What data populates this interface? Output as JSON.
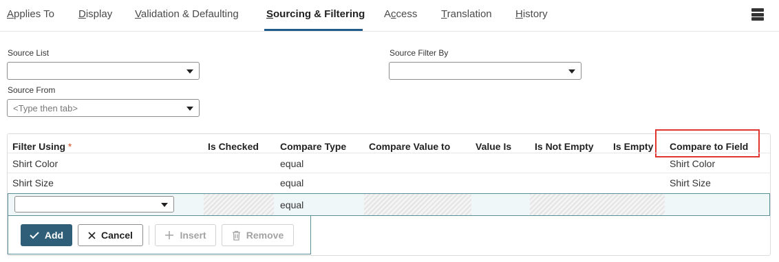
{
  "tabs": [
    {
      "label": "Applies To",
      "accel": "A",
      "rest": "pplies To"
    },
    {
      "label": "Display",
      "accel": "D",
      "rest": "isplay"
    },
    {
      "label": "Validation & Defaulting",
      "accel": "V",
      "rest": "alidation & Defaulting"
    },
    {
      "label": "Sourcing & Filtering",
      "accel": "S",
      "rest": "ourcing & Filtering"
    },
    {
      "label": "Access",
      "pre": "A",
      "accel": "c",
      "rest": "cess"
    },
    {
      "label": "Translation",
      "accel": "T",
      "rest": "ranslation"
    },
    {
      "label": "History",
      "accel": "H",
      "rest": "istory"
    }
  ],
  "active_tab": "Sourcing & Filtering",
  "form": {
    "source_list": {
      "label": "Source List",
      "value": ""
    },
    "source_filter_by": {
      "label": "Source Filter By",
      "value": ""
    },
    "source_from": {
      "label": "Source From",
      "placeholder": "<Type then tab>"
    }
  },
  "grid": {
    "columns": {
      "filter_using": "Filter Using",
      "required_mark": "*",
      "is_checked": "Is Checked",
      "compare_type": "Compare Type",
      "compare_value_to": "Compare Value to",
      "value_is": "Value Is",
      "is_not_empty": "Is Not Empty",
      "is_empty": "Is Empty",
      "compare_to_field": "Compare to Field"
    },
    "rows": [
      {
        "filter_using": "Shirt Color",
        "compare_type": "equal",
        "compare_to_field": "Shirt Color"
      },
      {
        "filter_using": "Shirt Size",
        "compare_type": "equal",
        "compare_to_field": "Shirt Size"
      }
    ],
    "edit_row": {
      "filter_using": "",
      "compare_type": "equal"
    }
  },
  "actions": {
    "add": "Add",
    "cancel": "Cancel",
    "insert": "Insert",
    "remove": "Remove"
  },
  "colors": {
    "accent": "#1f5a8a",
    "primary_button": "#2f5f78",
    "highlight": "#e0342e"
  }
}
